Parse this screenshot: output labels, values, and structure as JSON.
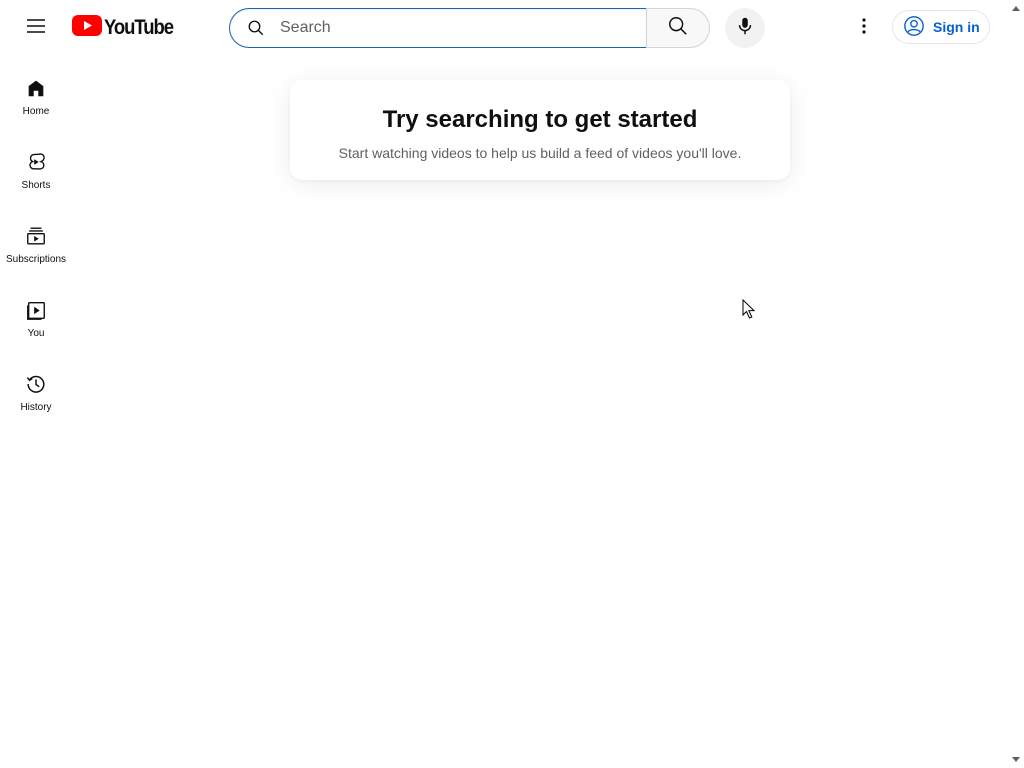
{
  "header": {
    "logo_text": "YouTube",
    "search": {
      "placeholder": "Search",
      "value": ""
    },
    "sign_in_label": "Sign in"
  },
  "sidebar": {
    "items": [
      {
        "label": "Home",
        "icon": "home-icon"
      },
      {
        "label": "Shorts",
        "icon": "shorts-icon"
      },
      {
        "label": "Subscriptions",
        "icon": "subscriptions-icon"
      },
      {
        "label": "You",
        "icon": "you-icon"
      },
      {
        "label": "History",
        "icon": "history-icon"
      }
    ]
  },
  "main": {
    "prompt_title": "Try searching to get started",
    "prompt_subtitle": "Start watching videos to help us build a feed of videos you'll love."
  },
  "colors": {
    "brand_red": "#ff0000",
    "link_blue": "#065fd4",
    "search_focus_border": "#1c62b9",
    "text_primary": "#0f0f0f",
    "text_secondary": "#606060"
  }
}
